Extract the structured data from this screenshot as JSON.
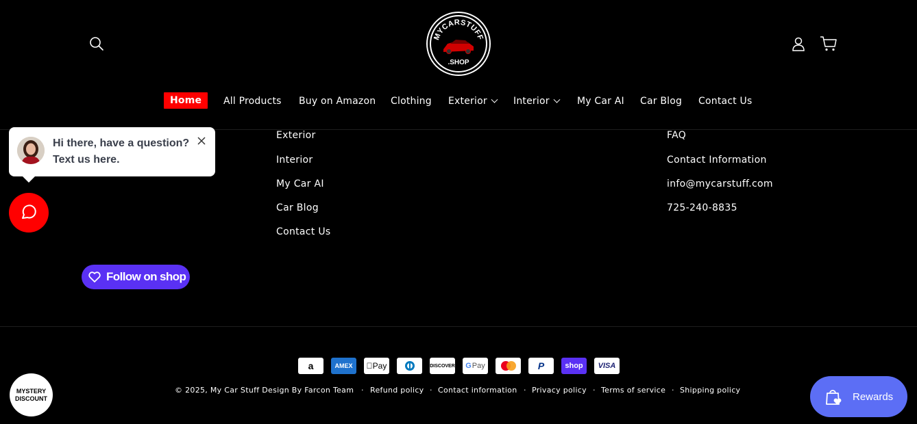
{
  "header": {
    "logo_top_text": "MYCARSTUFF",
    "logo_bottom_text": ".SHOP",
    "icons": {
      "search": "search-icon",
      "account": "user-icon",
      "cart": "cart-icon"
    }
  },
  "nav": {
    "items": [
      {
        "label": "Home",
        "active": true
      },
      {
        "label": "All Products"
      },
      {
        "label": "Buy on Amazon"
      },
      {
        "label": "Clothing"
      },
      {
        "label": "Exterior",
        "has_dropdown": true
      },
      {
        "label": "Interior",
        "has_dropdown": true
      },
      {
        "label": "My Car AI"
      },
      {
        "label": "Car Blog"
      },
      {
        "label": "Contact Us"
      }
    ]
  },
  "footer": {
    "menu_links": [
      "Exterior",
      "Interior",
      "My Car AI",
      "Car Blog",
      "Contact Us"
    ],
    "info_links": [
      "FAQ",
      "Contact Information",
      "info@mycarstuff.com",
      "725-240-8835"
    ],
    "follow_shop_label": "Follow on shop",
    "payment_methods": [
      "Amazon",
      "American Express",
      "Apple Pay",
      "Diners Club",
      "Discover",
      "Google Pay",
      "Mastercard",
      "PayPal",
      "Shop Pay",
      "Visa"
    ],
    "payment_labels": {
      "amex": "AMEX",
      "applepay": "Pay",
      "discover": "DISCOVER",
      "gpay": "Pay",
      "shop": "shop",
      "visa": "VISA",
      "paypal": "P",
      "amazon": "a"
    },
    "copyright": "© 2025, My Car Stuff Design By Farcon Team",
    "policies": [
      "Refund policy",
      "Contact information",
      "Privacy policy",
      "Terms of service",
      "Shipping policy"
    ],
    "separator": "·"
  },
  "widgets": {
    "chat_message": "Hi there, have a question? Text us here.",
    "mystery_line1": "MYSTERY",
    "mystery_line2": "DISCOUNT",
    "rewards_label": "Rewards"
  },
  "colors": {
    "background": "#000000",
    "accent": "#ff0000",
    "shop_purple": "#5a31f4",
    "rewards_blue": "#5c6ef5"
  }
}
